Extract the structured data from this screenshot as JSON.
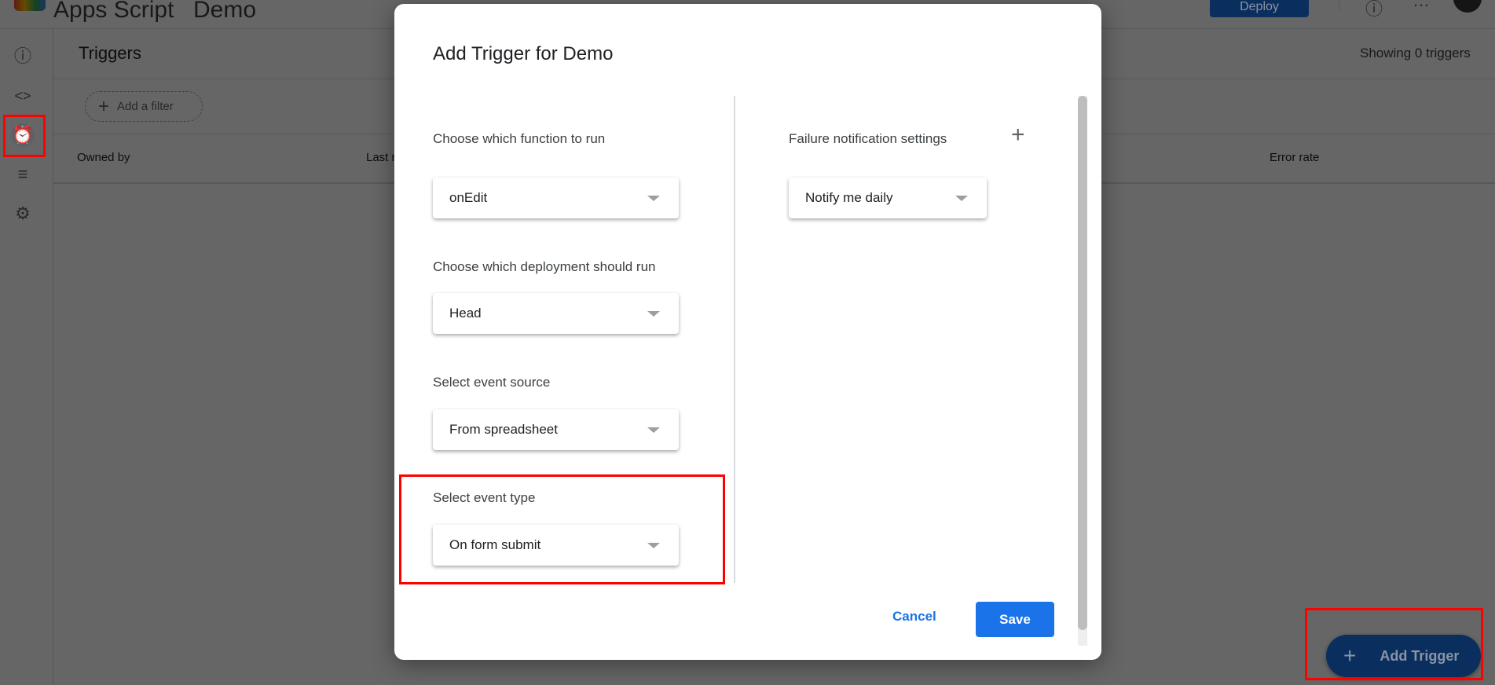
{
  "header": {
    "app_title": "Apps Script",
    "project_name": "Demo",
    "deploy_label": "Deploy",
    "help_icon": "help-icon",
    "more_icon": "more-horiz-icon"
  },
  "sidebar": {
    "items": [
      {
        "icon": "info-icon",
        "glyph": "ⓘ"
      },
      {
        "icon": "code-icon",
        "glyph": "<>"
      },
      {
        "icon": "alarm-clock-icon",
        "glyph": "⏰",
        "active": true
      },
      {
        "icon": "playlist-play-icon",
        "glyph": "≡"
      },
      {
        "icon": "gear-icon",
        "glyph": "⚙"
      }
    ]
  },
  "main": {
    "title": "Triggers",
    "count_text": "Showing 0 triggers",
    "filter_label": "Add a filter",
    "columns": [
      "Owned by",
      "Last r",
      "Error rate"
    ],
    "fab_label": "Add Trigger"
  },
  "dialog": {
    "title": "Add Trigger for Demo",
    "fields": [
      {
        "label": "Choose which function to run",
        "value": "onEdit"
      },
      {
        "label": "Choose which deployment should run",
        "value": "Head"
      },
      {
        "label": "Select event source",
        "value": "From spreadsheet"
      },
      {
        "label": "Select event type",
        "value": "On form submit"
      }
    ],
    "failure": {
      "label": "Failure notification settings",
      "value": "Notify me daily"
    },
    "cancel_label": "Cancel",
    "save_label": "Save"
  },
  "colors": {
    "accent": "#1a73e8",
    "highlight": "#ff0000"
  }
}
